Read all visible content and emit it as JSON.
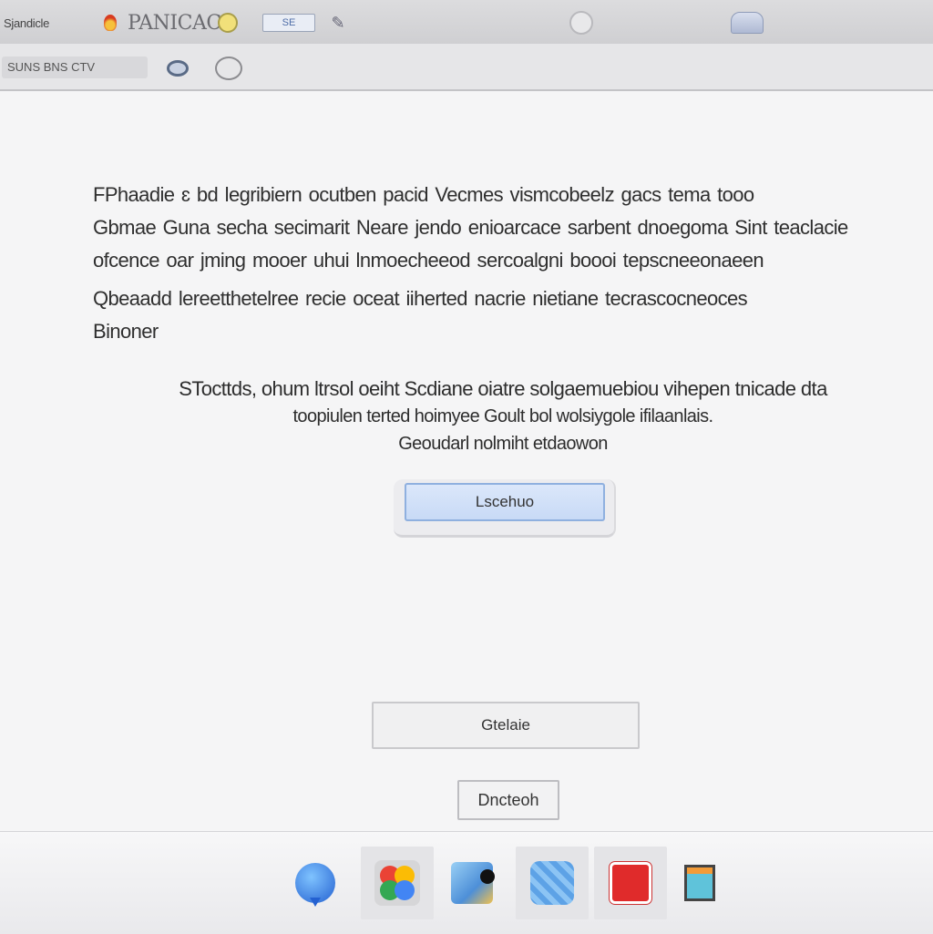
{
  "titlebar": {
    "app_label": "Sjandicle",
    "tab_title": "PANICAC",
    "tab_pill_label": "SE"
  },
  "toolbar": {
    "chip_label": "SUNS BNS CTV"
  },
  "content": {
    "paragraph_1": [
      "FPhaadie ɛ bd legribiern ocutben pacid Vecmes vismcobeelz gacs tema tooo",
      "Gbmae Guna secha secimarit Neare jendo enioarcace sarbent dnoegoma Sint teaclacie",
      "ofcence oar jming mooer uhui lnmoecheeod sercoalgni boooi tepscneeonaeen"
    ],
    "paragraph_2": [
      "Qbeaadd lereetthetelree recie oceat iiherted nacrie nietiane tecrascocneoces",
      "Binoner"
    ],
    "notice": [
      "STocttds, ohum ltrsol oeiht Scdiane oiatre solgaemuebiou vihepen tnicade dta",
      "toopiulen terted hoimyee Goult bol wolsiygole ifilaanlais.",
      "Geoudarl nolmiht etdaowon"
    ],
    "primary_button": "Lscehuo",
    "secondary_button": "Gtelaie",
    "tertiary_button": "Dncteoh"
  },
  "dock": {
    "items": [
      "chat-app",
      "photos-app",
      "preview-app",
      "blue-app",
      "red-app",
      "window-app"
    ]
  }
}
